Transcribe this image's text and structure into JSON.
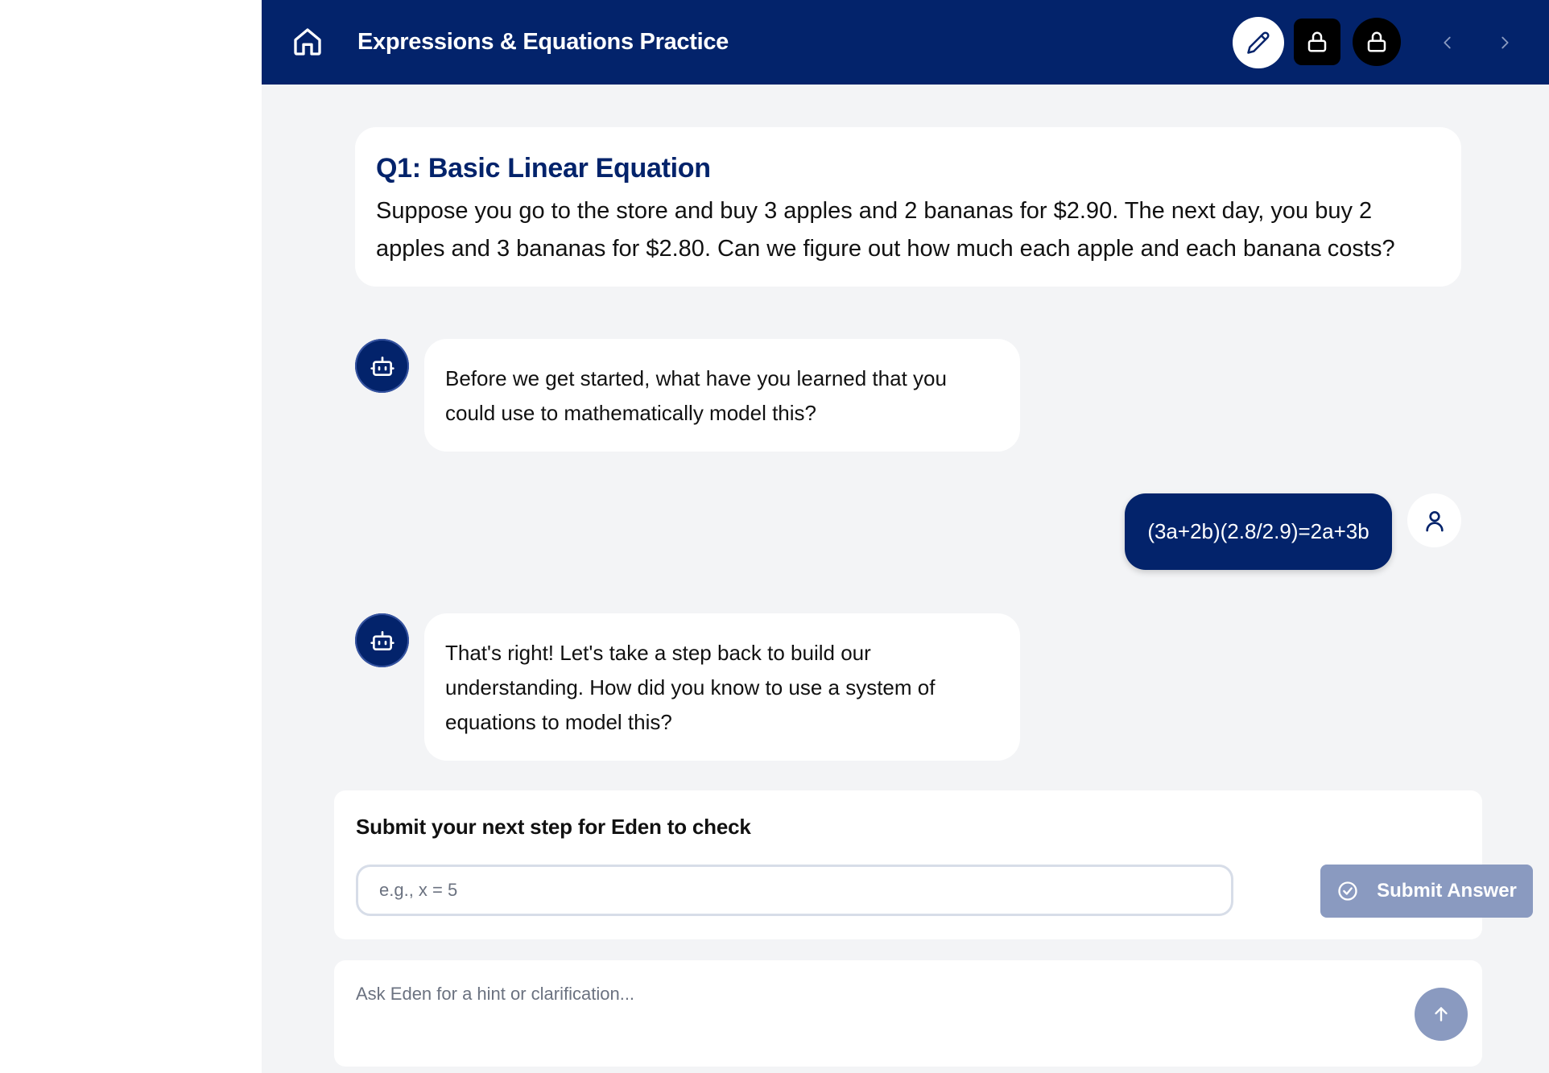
{
  "header": {
    "title": "Expressions & Equations Practice",
    "icons": {
      "home": "home-icon",
      "edit": "pencil-icon",
      "lock_square": "lock-icon",
      "lock_round": "lock-icon",
      "prev": "chevron-left-icon",
      "next": "chevron-right-icon"
    }
  },
  "question": {
    "title": "Q1: Basic Linear Equation",
    "text": "Suppose you go to the store and buy 3 apples and 2 bananas for $2.90. The next day, you buy 2 apples and 3 bananas for $2.80. Can we figure out how much each apple and each banana costs?"
  },
  "chat": {
    "messages": [
      {
        "role": "bot",
        "text": "Before we get started, what have you learned that you could use to mathematically model this?"
      },
      {
        "role": "user",
        "text": "(3a+2b)(2.8/2.9)=2a+3b"
      },
      {
        "role": "bot",
        "text": "That's right! Let's take a step back to build our understanding. How did you know to use a system of equations to model this?"
      }
    ]
  },
  "submit_panel": {
    "label": "Submit your next step for Eden to check",
    "placeholder": "e.g., x = 5",
    "button_label": "Submit Answer"
  },
  "hint_panel": {
    "placeholder": "Ask Eden for a hint or clarification..."
  },
  "colors": {
    "primary": "#03236b",
    "background": "#f3f4f6",
    "disabled_button": "#8a9ac0"
  }
}
